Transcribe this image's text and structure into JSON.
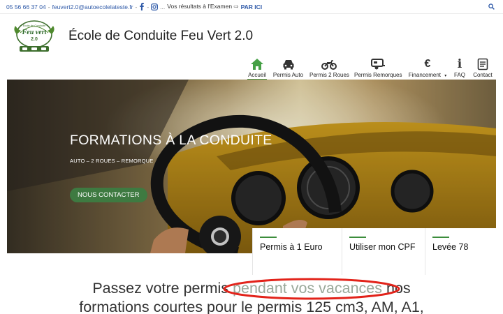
{
  "topbar": {
    "phone": "05 56 66 37 04",
    "email": "feuvert2.0@autoecolelateste.fr",
    "sep1": "-",
    "sep2": "-",
    "sep3": "-",
    "dots": "...",
    "results_text": "Vos résultats à l'Examen ⇨",
    "results_link": "PAR ICI"
  },
  "header": {
    "site_title": "École de Conduite Feu Vert 2.0",
    "logo_text_top": "Feu vert",
    "logo_text_arc": "École de Conduite",
    "logo_text_num": "2.0"
  },
  "nav": {
    "items": [
      {
        "label": "Accueil",
        "icon": "home-icon"
      },
      {
        "label": "Permis Auto",
        "icon": "car-icon"
      },
      {
        "label": "Permis 2 Roues",
        "icon": "motorcycle-icon"
      },
      {
        "label": "Permis Remorques",
        "icon": "trailer-icon"
      },
      {
        "label": "Financement",
        "icon": "euro-icon",
        "symbol": "€",
        "caret": "▾"
      },
      {
        "label": "FAQ",
        "icon": "info-icon",
        "symbol": "i"
      },
      {
        "label": "Contact",
        "icon": "contact-card-icon"
      }
    ]
  },
  "hero": {
    "title": "FORMATIONS À LA CONDUITE",
    "subtitle": "AUTO  – 2 ROUES – REMORQUE",
    "button": "NOUS CONTACTER"
  },
  "cards": [
    {
      "label": "Permis à 1 Euro"
    },
    {
      "label": "Utiliser mon CPF"
    },
    {
      "label": "Levée 78"
    }
  ],
  "headline": {
    "before": "Passez votre permis ",
    "highlight": "pendant vos vacances",
    "after_line1": " nos",
    "line2": "formations courtes pour le permis 125 cm3, AM, A1,"
  },
  "colors": {
    "accent_green": "#3c8d3c",
    "button_green": "#3e7a41",
    "link_blue": "#2f5aa8",
    "ellipse_red": "#e2231a"
  }
}
